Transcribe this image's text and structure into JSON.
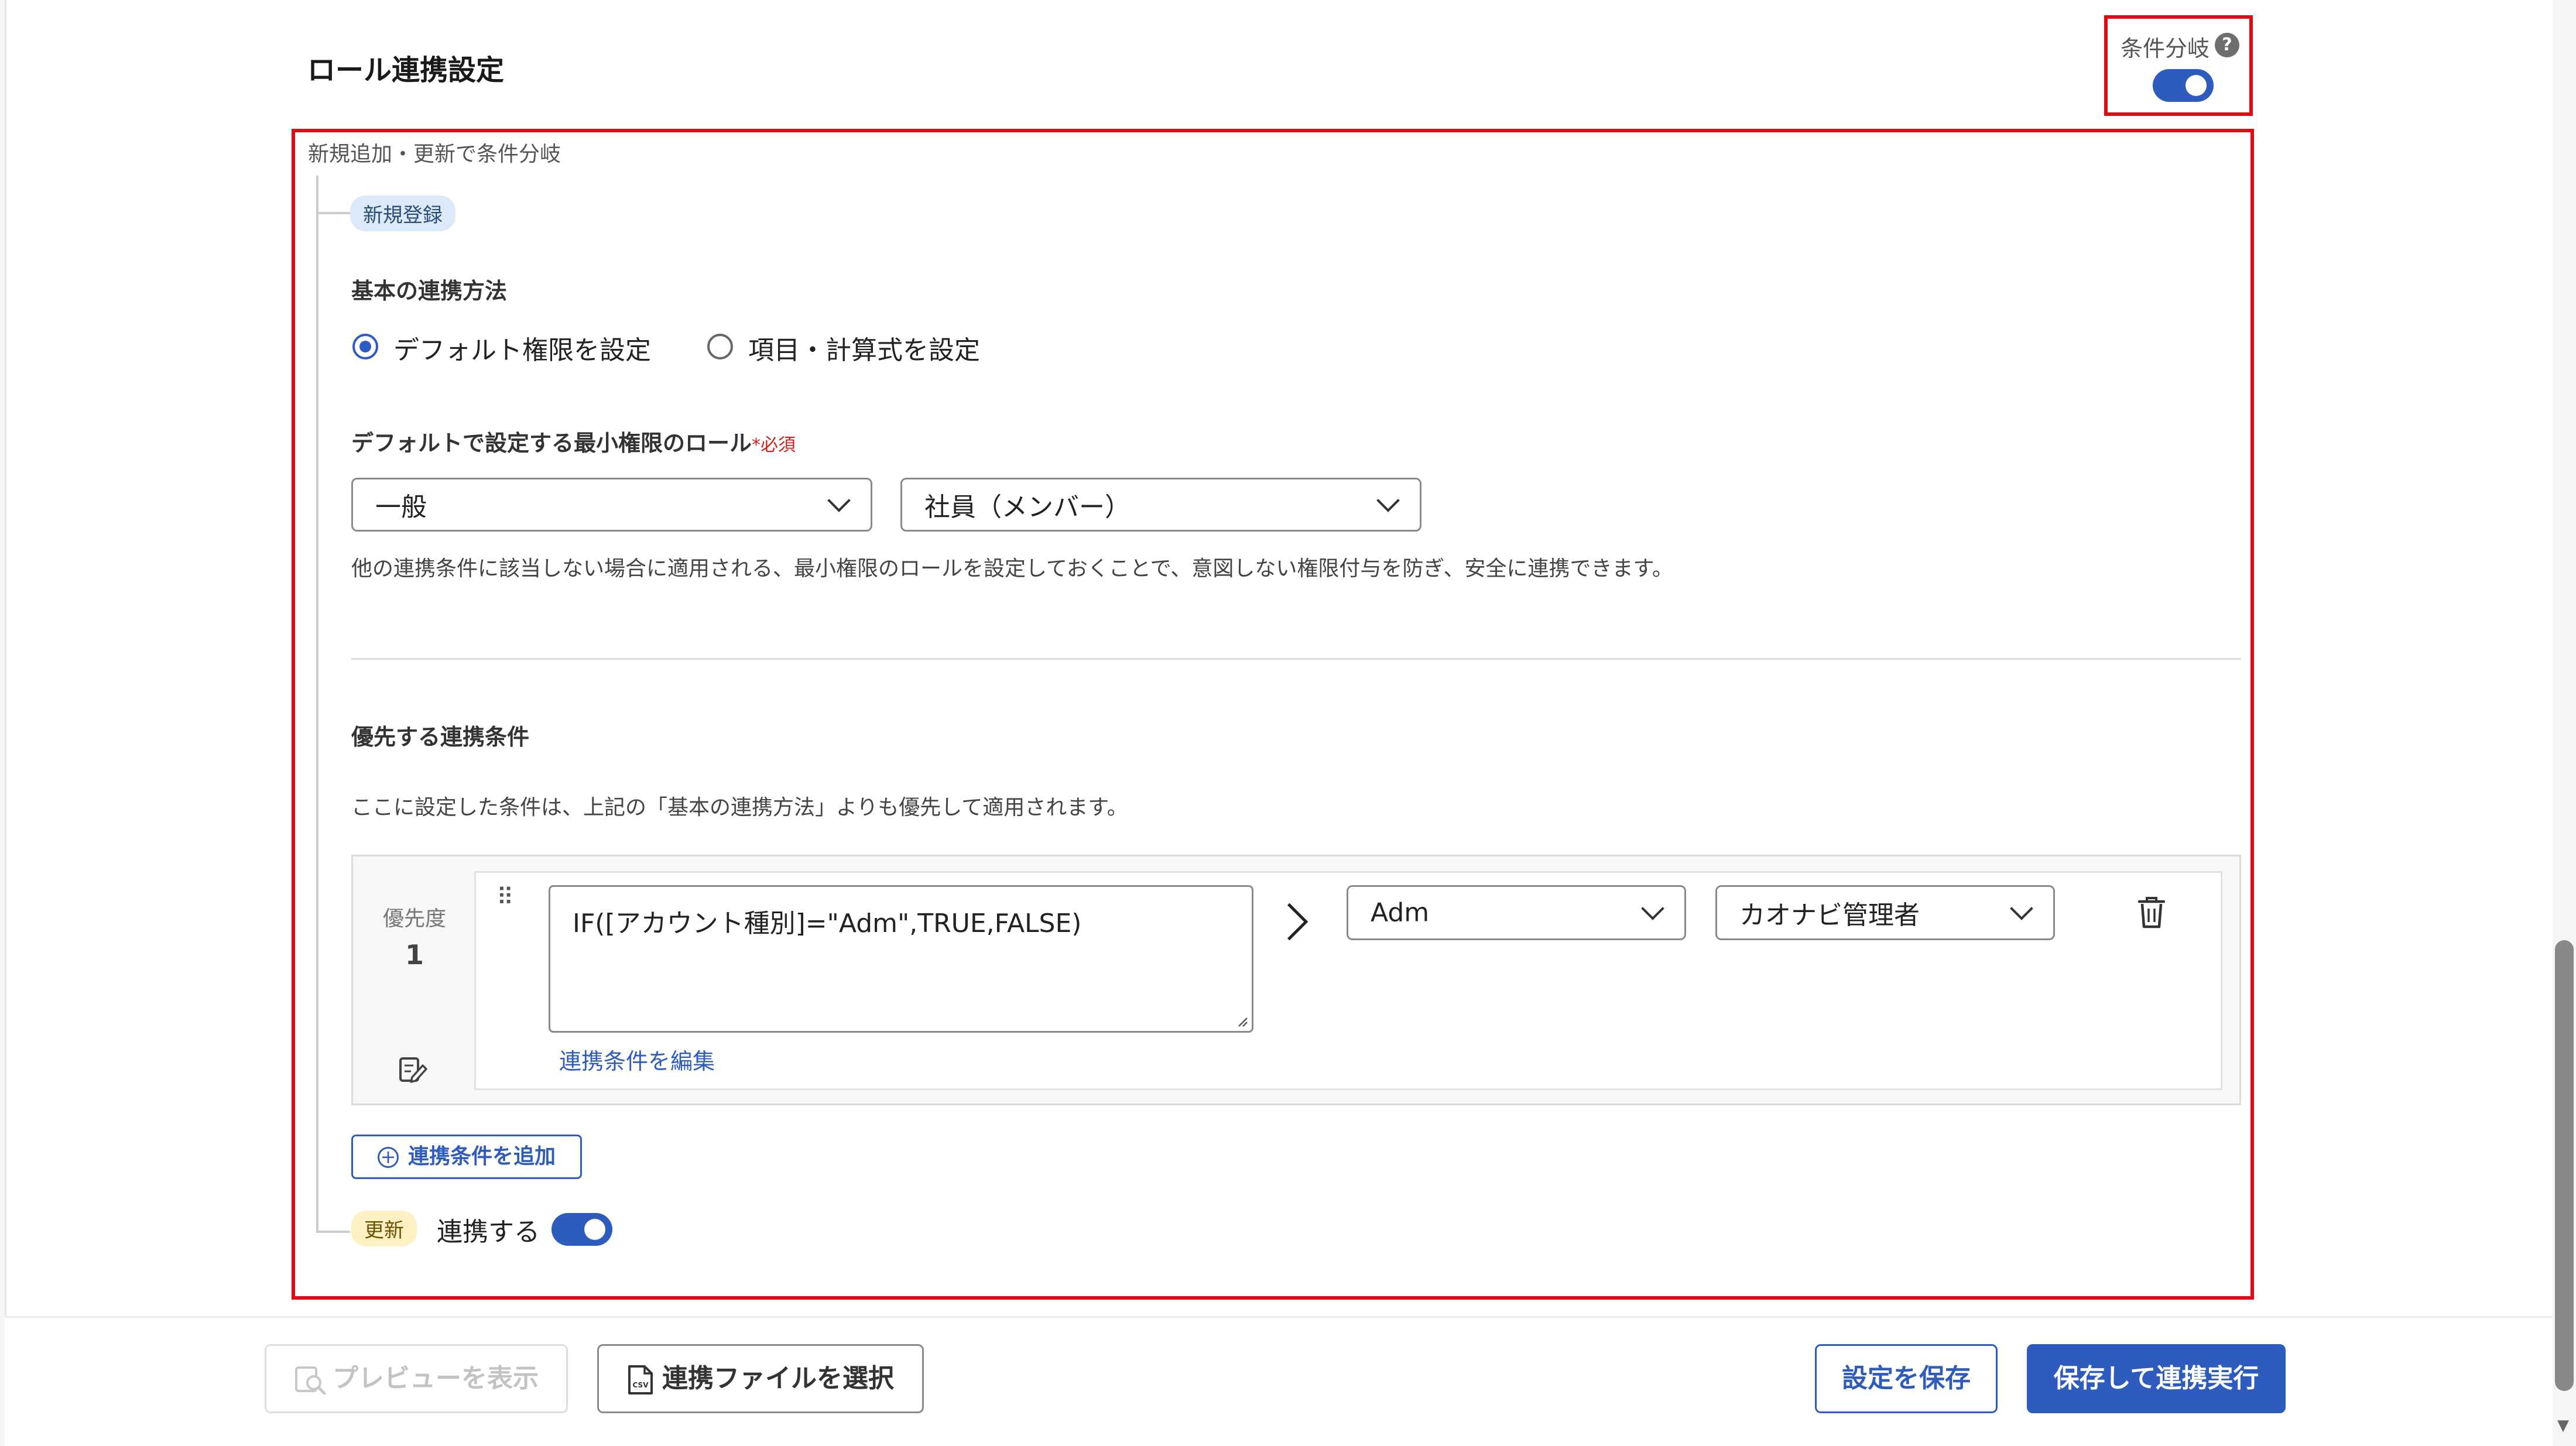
{
  "section": {
    "title": "ロール連携設定",
    "branch_toggle_label": "条件分岐",
    "branch_toggle_on": true,
    "branch_caption": "新規追加・更新で条件分岐"
  },
  "new_registration": {
    "tag": "新規登録",
    "basic_method_label": "基本の連携方法",
    "options": [
      "デフォルト権限を設定",
      "項目・計算式を設定"
    ],
    "selected_option": 0,
    "default_role_label": "デフォルトで設定する最小権限のロール",
    "required_mark": "*",
    "required_text": "必須",
    "role_select_1": "一般",
    "role_select_2": "社員（メンバー）",
    "hint": "他の連携条件に該当しない場合に適用される、最小権限のロールを設定しておくことで、意図しない権限付与を防ぎ、安全に連携できます。"
  },
  "priority_conditions": {
    "title": "優先する連携条件",
    "description": "ここに設定した条件は、上記の「基本の連携方法」よりも優先して適用されます。",
    "rows": [
      {
        "priority_label": "優先度",
        "priority": "1",
        "formula": "IF([アカウント種別]=\"Adm\",TRUE,FALSE)",
        "edit_link": "連携条件を編集",
        "value_select": "Adm",
        "role_select": "カオナビ管理者"
      }
    ],
    "add_button": "連携条件を追加"
  },
  "update": {
    "tag": "更新",
    "label": "連携する",
    "toggle_on": true
  },
  "footer": {
    "preview_button": "プレビューを表示",
    "select_file_button": "連携ファイルを選択",
    "save_button": "設定を保存",
    "save_and_run_button": "保存して連携実行"
  },
  "colors": {
    "accent": "#2e5cbe",
    "highlight_border": "#e30a17",
    "required": "#d41e1e"
  }
}
